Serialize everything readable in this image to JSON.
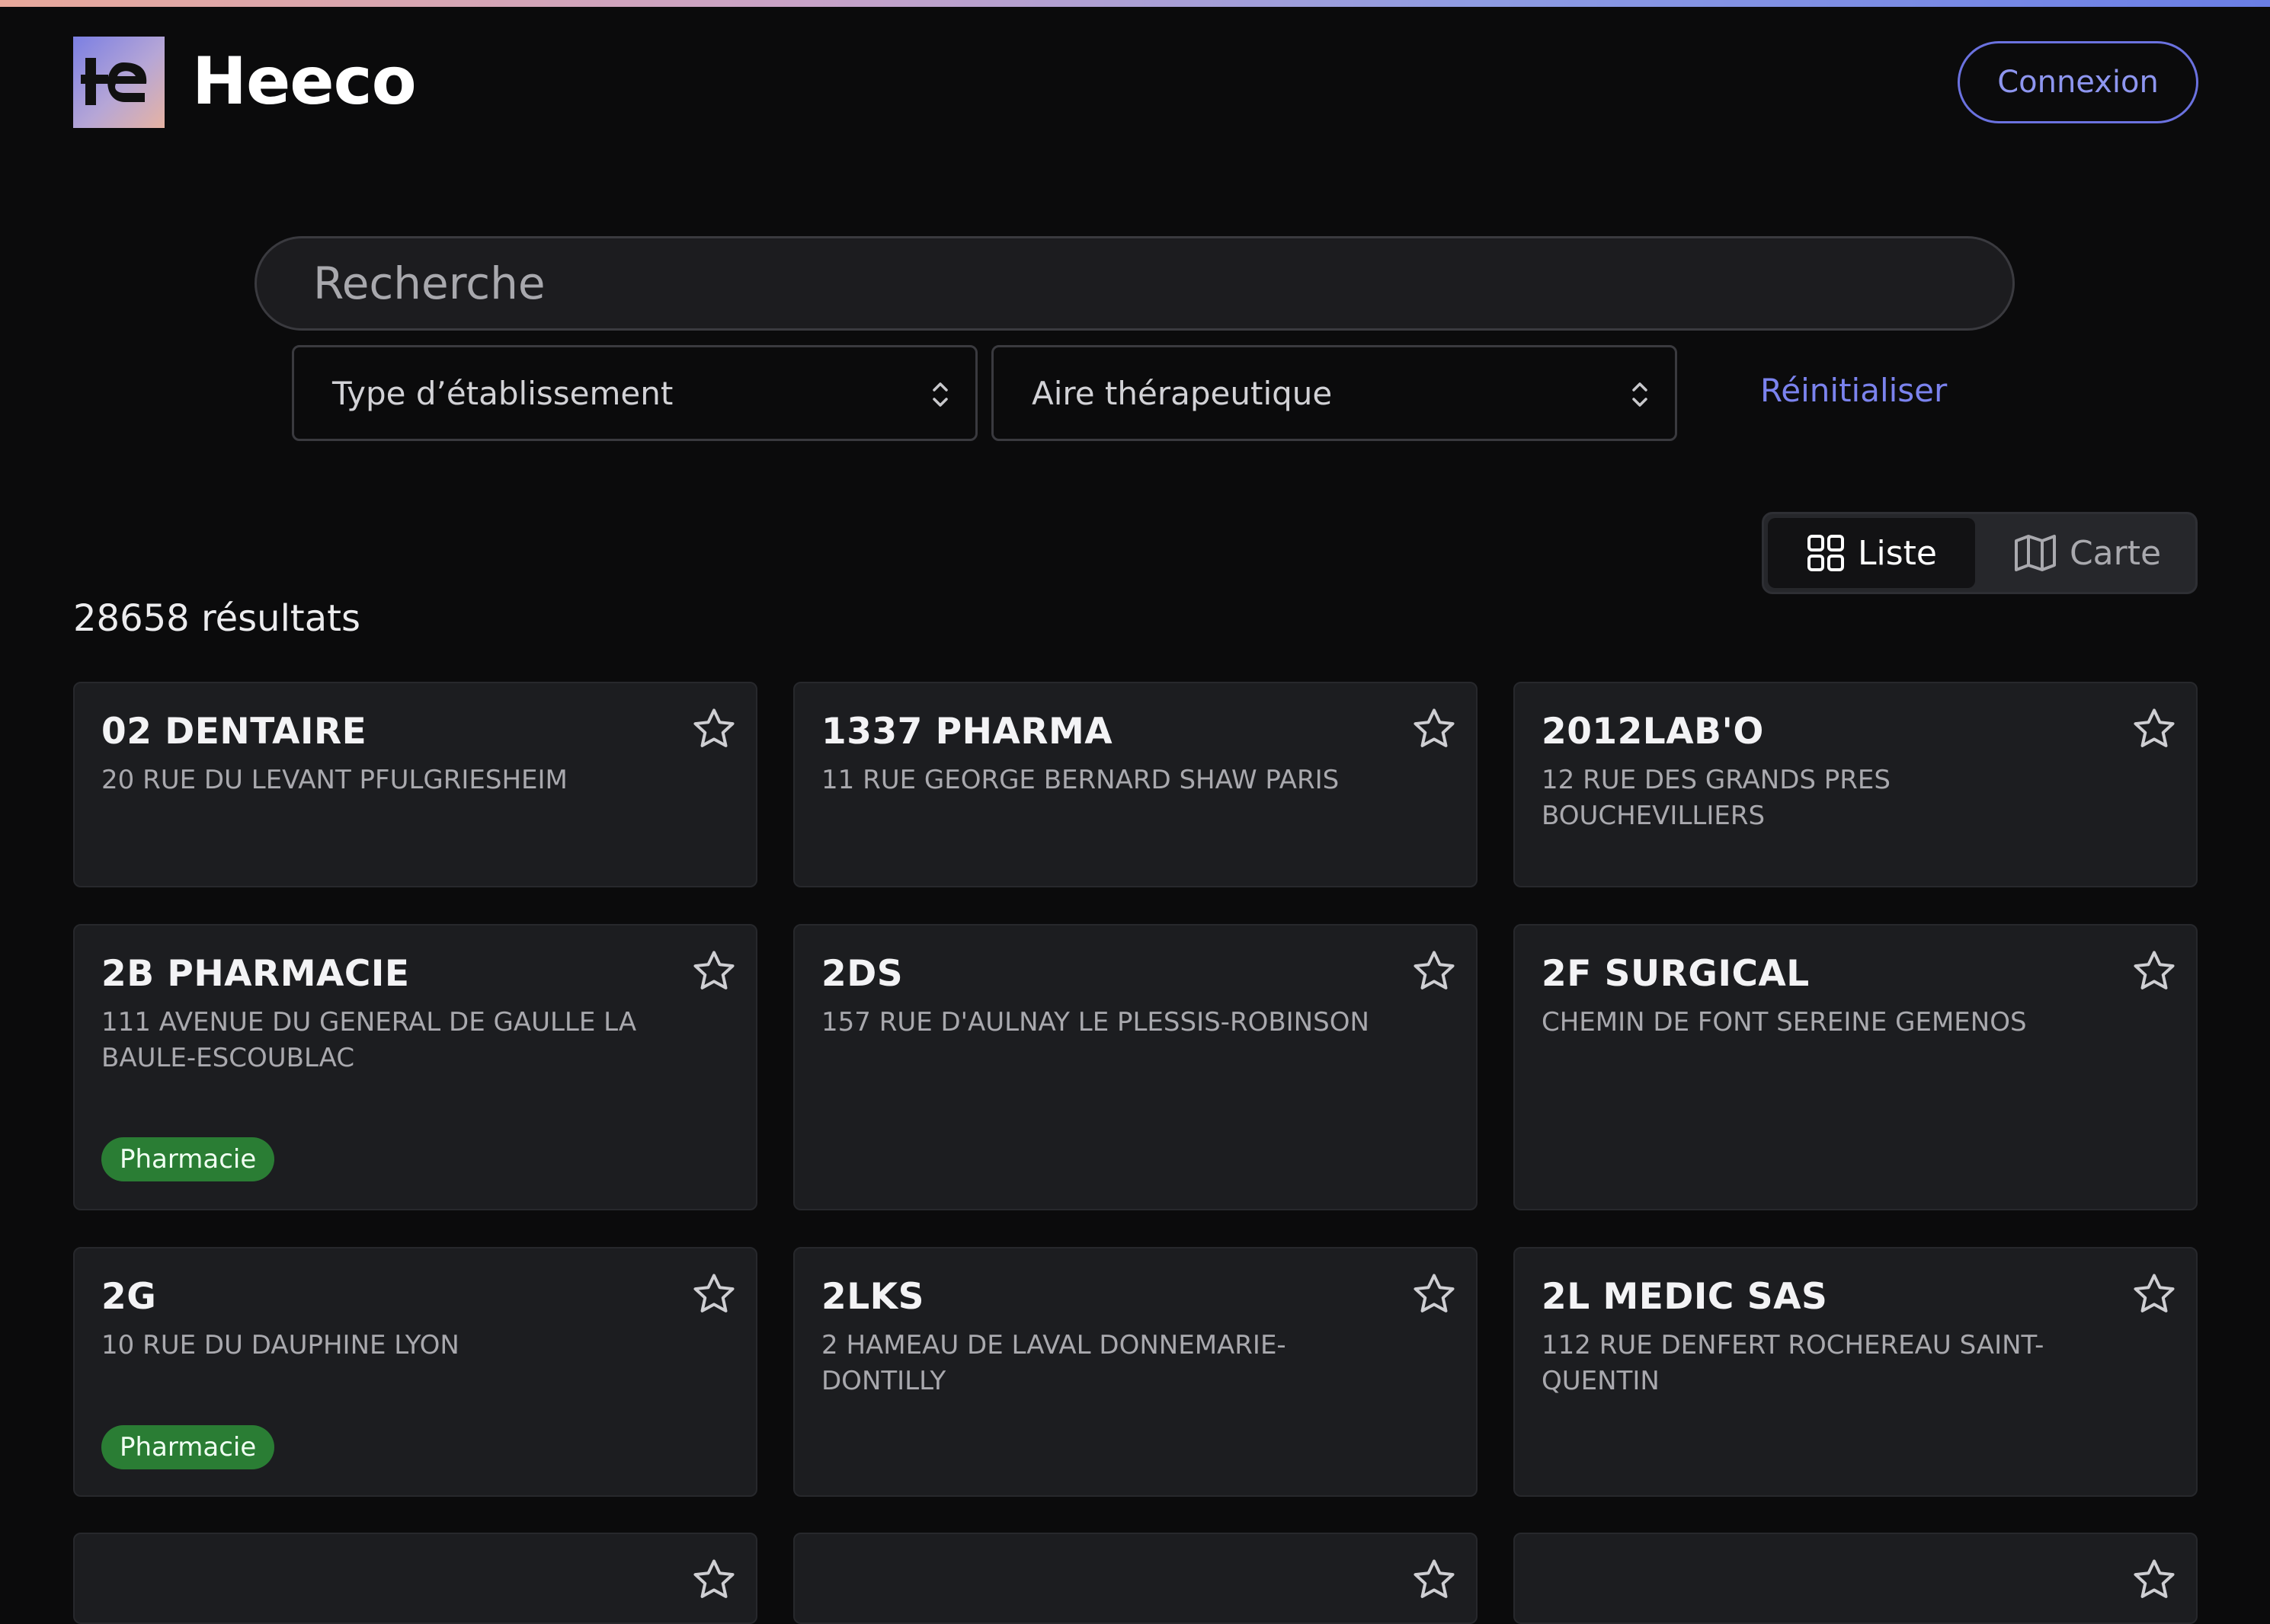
{
  "header": {
    "brand": "Heeco",
    "login_label": "Connexion"
  },
  "search": {
    "placeholder": "Recherche"
  },
  "filters": {
    "type_label": "Type d’établissement",
    "aire_label": "Aire thérapeutique",
    "reset_label": "Réinitialiser"
  },
  "view_toggle": {
    "liste_label": "Liste",
    "carte_label": "Carte",
    "selected": "Liste"
  },
  "results": {
    "count_text": "28658 résultats",
    "cards": [
      {
        "name": "02 DENTAIRE",
        "address": "20 RUE DU LEVANT PFULGRIESHEIM",
        "badge": ""
      },
      {
        "name": "1337 PHARMA",
        "address": "11 RUE GEORGE BERNARD SHAW PARIS",
        "badge": ""
      },
      {
        "name": "2012LAB'O",
        "address": "12 RUE DES GRANDS PRES BOUCHEVILLIERS",
        "badge": ""
      },
      {
        "name": "2B PHARMACIE",
        "address": "111 AVENUE DU GENERAL DE GAULLE LA BAULE-ESCOUBLAC",
        "badge": "Pharmacie"
      },
      {
        "name": "2DS",
        "address": "157 RUE D'AULNAY LE PLESSIS-ROBINSON",
        "badge": ""
      },
      {
        "name": "2F SURGICAL",
        "address": "CHEMIN DE FONT SEREINE GEMENOS",
        "badge": ""
      },
      {
        "name": "2G",
        "address": "10 RUE DU DAUPHINE LYON",
        "badge": "Pharmacie"
      },
      {
        "name": "2LKS",
        "address": "2 HAMEAU DE LAVAL DONNEMARIE-DONTILLY",
        "badge": ""
      },
      {
        "name": "2L MEDIC SAS",
        "address": "112 RUE DENFERT ROCHEREAU SAINT-QUENTIN",
        "badge": ""
      }
    ]
  },
  "colors": {
    "accent": "#6b72e0",
    "badge_green": "#2a7d34",
    "card_bg": "#1c1d20",
    "page_bg": "#0b0b0c"
  },
  "icons": {
    "logo": "heeco-logo-icon",
    "star": "star-outline-icon",
    "grid": "grid-icon",
    "map": "map-icon",
    "chevron": "updown-chevron-icon"
  }
}
